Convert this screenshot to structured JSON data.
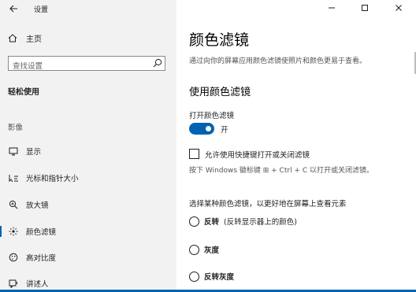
{
  "window": {
    "title": "设置",
    "back_icon": "back-arrow-icon",
    "controls": [
      "minimize-icon",
      "maximize-icon",
      "close-icon"
    ]
  },
  "sidebar": {
    "home_label": "主页",
    "search_placeholder": "查找设置",
    "category": "轻松使用",
    "section": "影像",
    "items": [
      {
        "label": "显示",
        "icon": "monitor-icon",
        "active": false
      },
      {
        "label": "光标和指针大小",
        "icon": "cursor-icon",
        "active": false
      },
      {
        "label": "放大镜",
        "icon": "magnifier-icon",
        "active": false
      },
      {
        "label": "颜色滤镜",
        "icon": "color-filter-icon",
        "active": true
      },
      {
        "label": "高对比度",
        "icon": "contrast-icon",
        "active": false
      },
      {
        "label": "讲述人",
        "icon": "narrator-icon",
        "active": false
      }
    ]
  },
  "main": {
    "title": "颜色滤镜",
    "description": "通过向你的屏幕应用颜色滤镜使照片和颜色更易于查看。",
    "subheading": "使用颜色滤镜",
    "toggle_label": "打开颜色滤镜",
    "toggle_state": "开",
    "toggle_on": true,
    "shortcut_checkbox_label": "允许使用快捷键打开或关闭滤镜",
    "shortcut_checked": false,
    "shortcut_hint": "按下 Windows 徽标键 ⊞ + Ctrl + C 以打开或关闭滤镜。",
    "filter_prompt": "选择某种颜色滤镜，以更好地在屏幕上查看元素",
    "filters": [
      {
        "label": "反转",
        "note": "(反转显示器上的颜色)"
      },
      {
        "label": "灰度",
        "note": ""
      },
      {
        "label": "反转灰度",
        "note": ""
      }
    ]
  },
  "colors": {
    "accent": "#0063b1",
    "sidebar_bg": "#f2f2f2"
  }
}
